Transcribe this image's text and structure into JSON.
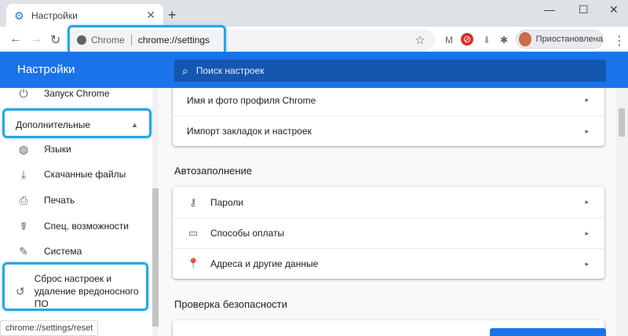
{
  "browser": {
    "tab": {
      "title": "Настройки",
      "close": "✕",
      "icon": "gear-icon"
    },
    "new_tab": "+",
    "window_controls": {
      "minimize": "—",
      "maximize": "☐",
      "close": "✕"
    },
    "nav": {
      "back": "←",
      "forward": "→",
      "reload": "↻"
    },
    "omnibox": {
      "scheme_label": "Chrome",
      "url": "chrome://settings",
      "star": "☆"
    },
    "profile": {
      "status": "Приостановлена"
    },
    "menu": "⋮",
    "status_url": "chrome://settings/reset"
  },
  "header": {
    "title": "Настройки",
    "search_placeholder": "Поиск настроек"
  },
  "sidebar": {
    "items": [
      {
        "label": "Запуск Chrome",
        "icon": "power-icon",
        "glyph": "⏻"
      },
      {
        "label": "Дополнительные",
        "icon": "caret-up-icon",
        "glyph": "▲"
      },
      {
        "label": "Языки",
        "icon": "globe-icon",
        "glyph": "🌐"
      },
      {
        "label": "Скачанные файлы",
        "icon": "download-icon",
        "glyph": "⤓"
      },
      {
        "label": "Печать",
        "icon": "print-icon",
        "glyph": "⎙"
      },
      {
        "label": "Спец. возможности",
        "icon": "accessibility-icon",
        "glyph": "♿"
      },
      {
        "label": "Система",
        "icon": "wrench-icon",
        "glyph": "🔧"
      },
      {
        "label": "Сброс настроек и удаление вредоносного ПО",
        "icon": "restore-icon",
        "glyph": "↺"
      }
    ]
  },
  "main": {
    "card1": [
      {
        "label": "Имя и фото профиля Chrome"
      },
      {
        "label": "Импорт закладок и настроек"
      }
    ],
    "autofill": {
      "title": "Автозаполнение",
      "rows": [
        {
          "label": "Пароли",
          "icon": "key-icon",
          "glyph": "⚷"
        },
        {
          "label": "Способы оплаты",
          "icon": "credit-card-icon",
          "glyph": "▭"
        },
        {
          "label": "Адреса и другие данные",
          "icon": "location-pin-icon",
          "glyph": "⬤"
        }
      ]
    },
    "safety": {
      "title": "Проверка безопасности"
    },
    "arrow": "▸"
  },
  "colors": {
    "accent": "#1a73e8",
    "highlight": "#29a6e0"
  }
}
